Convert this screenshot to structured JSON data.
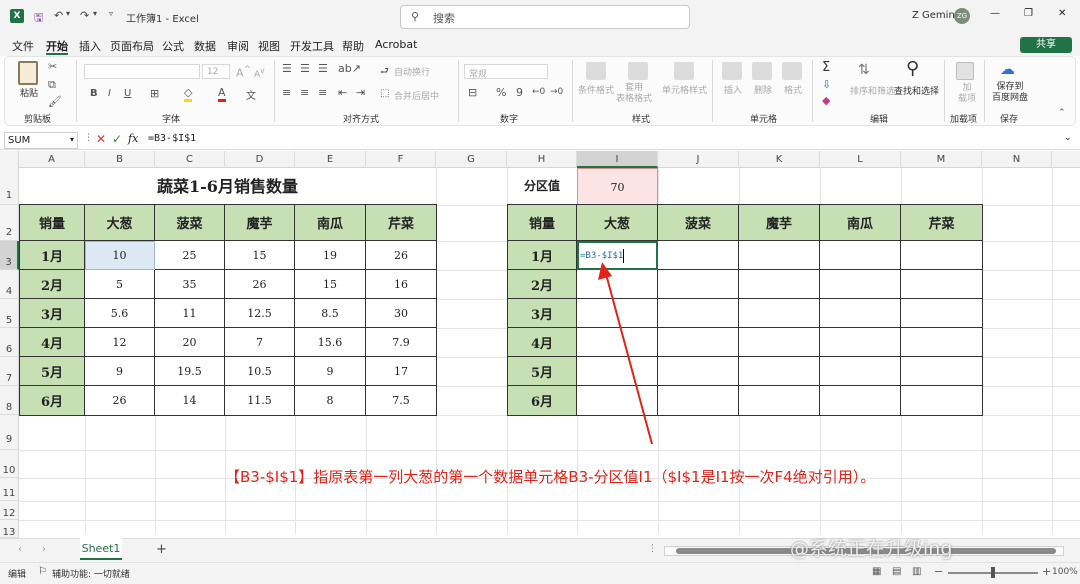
{
  "window": {
    "title": "工作簿1 - Excel",
    "search_placeholder": "搜索",
    "user": "Z Gemini",
    "avatar_initials": "ZG",
    "minimize": "—",
    "maximize": "❐",
    "close": "✕"
  },
  "menu": {
    "items": [
      "文件",
      "开始",
      "插入",
      "页面布局",
      "公式",
      "数据",
      "审阅",
      "视图",
      "开发工具",
      "帮助",
      "Acrobat"
    ],
    "active": "开始",
    "share": "共享"
  },
  "ribbon": {
    "groups": [
      "剪贴板",
      "字体",
      "对齐方式",
      "数字",
      "样式",
      "单元格",
      "编辑",
      "加载项",
      "保存"
    ],
    "paste": "粘贴",
    "font_size": "12",
    "wrap_text": "自动换行",
    "merge_center": "合并后居中",
    "number_format": "常规",
    "percent": "%",
    "comma": "9",
    "cond_format": "条件格式",
    "table_format": "套用\n表格格式",
    "cell_style": "单元格样式",
    "insert": "插入",
    "delete": "删除",
    "format": "格式",
    "sort_filter": "排序和筛选",
    "find_select": "查找和选择",
    "addins": "加\n载项",
    "save_baidu": "保存到\n百度网盘",
    "bold": "B",
    "italic": "I",
    "underline": "U"
  },
  "formula_bar": {
    "name_box": "SUM",
    "content": "=B3-$I$1",
    "fx": "fx"
  },
  "columns": [
    "A",
    "B",
    "C",
    "D",
    "E",
    "F",
    "G",
    "H",
    "I",
    "J",
    "K",
    "L",
    "M",
    "N"
  ],
  "rows": [
    "1",
    "2",
    "3",
    "4",
    "5",
    "6",
    "7",
    "8",
    "9",
    "10",
    "11",
    "12",
    "13"
  ],
  "left_table": {
    "title": "蔬菜1-6月销售数量",
    "headers": [
      "销量",
      "大葱",
      "菠菜",
      "魔芋",
      "南瓜",
      "芹菜"
    ],
    "rows": [
      [
        "1月",
        "10",
        "25",
        "15",
        "19",
        "26"
      ],
      [
        "2月",
        "5",
        "35",
        "26",
        "15",
        "16"
      ],
      [
        "3月",
        "5.6",
        "11",
        "12.5",
        "8.5",
        "30"
      ],
      [
        "4月",
        "12",
        "20",
        "7",
        "15.6",
        "7.9"
      ],
      [
        "5月",
        "9",
        "19.5",
        "10.5",
        "9",
        "17"
      ],
      [
        "6月",
        "26",
        "14",
        "11.5",
        "8",
        "7.5"
      ]
    ]
  },
  "right_table": {
    "partition_label": "分区值",
    "partition_value": "70",
    "headers": [
      "销量",
      "大葱",
      "菠菜",
      "魔芋",
      "南瓜",
      "芹菜"
    ],
    "months": [
      "1月",
      "2月",
      "3月",
      "4月",
      "5月",
      "6月"
    ],
    "editing_cell": "=B3-$I$1"
  },
  "annotation": "【B3-$I$1】指原表第一列大葱的第一个数据单元格B3-分区值I1（$I$1是I1按一次F4绝对引用）。",
  "sheet_tabs": {
    "active": "Sheet1",
    "add": "+"
  },
  "status": {
    "mode": "编辑",
    "accessibility": "辅助功能: 一切就绪",
    "zoom": "100%"
  },
  "watermark": "@系统正在升级ing",
  "colors": {
    "header_green": "#c6e0b4",
    "excel_green": "#217346",
    "annotation_red": "#e2231a",
    "partition_fill": "#fce4e4"
  }
}
